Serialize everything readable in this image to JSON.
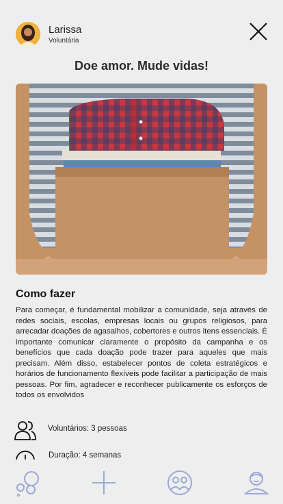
{
  "header": {
    "user_name": "Larissa",
    "user_role": "Voluntária",
    "close_icon": "close-icon"
  },
  "page_title": "Doe amor. Mude vidas!",
  "hero_image": {
    "description_icon": "donation-box-image"
  },
  "section": {
    "title": "Como fazer",
    "body": "Para começar, é fundamental mobilizar a comunidade, seja através de redes sociais, escolas, empresas locais ou grupos religiosos, para arrecadar doações de agasalhos, cobertores e outros itens essenciais. É importante comunicar claramente o propósito da campanha e os benefícios que cada doação pode trazer para aqueles que mais precisam. Além disso, estabelecer pontos de coleta estratégicos e horários de funcionamento flexíveis pode facilitar a participação de mais pessoas. Por fim, agradecer e reconhecer publicamente os esforços de todos os envolvidos"
  },
  "info": {
    "volunteers": "Voluntários: 3 pessoas",
    "duration": "Duração: 4 semanas"
  },
  "bottom_nav": {
    "items": [
      "bubbles-icon",
      "plus-icon",
      "community-icon",
      "profile-icon"
    ]
  },
  "colors": {
    "accent": "#9aa8d8",
    "background": "#eeeeee",
    "text": "#222222"
  }
}
